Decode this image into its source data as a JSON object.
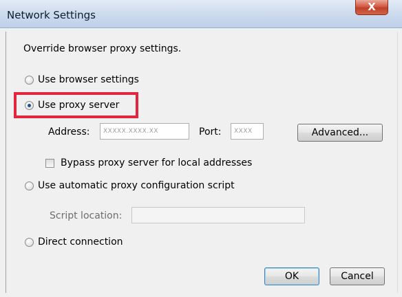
{
  "window": {
    "title": "Network Settings",
    "close_label": "X"
  },
  "heading": "Override browser proxy settings.",
  "options": {
    "browser": "Use browser settings",
    "proxy": "Use proxy server",
    "auto": "Use automatic proxy configuration script",
    "direct": "Direct connection",
    "selected": "proxy"
  },
  "proxy": {
    "address_label": "Address:",
    "address_value": "XXXXX.XXXX.XX",
    "port_label": "Port:",
    "port_value": "XXXX",
    "advanced_label": "Advanced...",
    "bypass_label": "Bypass proxy server for local addresses"
  },
  "script": {
    "location_label": "Script location:",
    "location_value": ""
  },
  "buttons": {
    "ok": "OK",
    "cancel": "Cancel"
  },
  "colors": {
    "highlight": "#e3263f",
    "radio_dot": "#1f4f8f"
  }
}
